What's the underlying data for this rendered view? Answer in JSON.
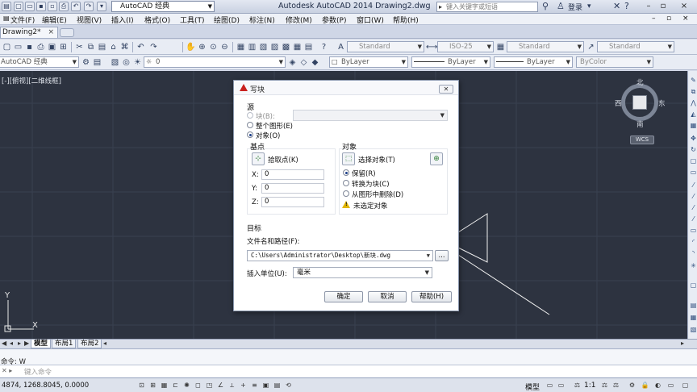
{
  "titlebar": {
    "workspace": "AutoCAD 经典",
    "app_title": "Autodesk AutoCAD 2014    Drawing2.dwg",
    "search_placeholder": "键入关键字或短语",
    "login": "登录"
  },
  "menus": [
    "文件(F)",
    "编辑(E)",
    "视图(V)",
    "插入(I)",
    "格式(O)",
    "工具(T)",
    "绘图(D)",
    "标注(N)",
    "修改(M)",
    "参数(P)",
    "窗口(W)",
    "帮助(H)"
  ],
  "doc_tab": {
    "label": "Drawing2*"
  },
  "toolbar1": {
    "text_style": "Standard",
    "dim_style": "ISO-25",
    "table_style": "Standard",
    "mleader_style": "Standard"
  },
  "toolbar2": {
    "workspace": "AutoCAD 经典",
    "layer": "0",
    "color": "ByLayer",
    "linetype": "ByLayer",
    "lineweight": "ByLayer",
    "plotstyle": "ByColor"
  },
  "canvas": {
    "viewport_label": "[-][俯视][二维线框]",
    "compass": {
      "north": "北",
      "south": "南",
      "east": "东",
      "west": "西"
    },
    "wcs": "WCS",
    "ucs_x": "X",
    "ucs_y": "Y"
  },
  "layout_tabs": [
    "模型",
    "布局1",
    "布局2"
  ],
  "command": {
    "history": "命令: W",
    "placeholder": "键入命令"
  },
  "statusbar": {
    "coords": "4874, 1268.8045, 0.0000",
    "model": "模型",
    "scale": "1:1"
  },
  "dialog": {
    "title": "写块",
    "source_heading": "源",
    "source_block": "块(B):",
    "source_drawing": "整个图形(E)",
    "source_objects": "对象(O)",
    "basepoint_heading": "基点",
    "pick_point": "拾取点(K)",
    "x_label": "X:",
    "x_value": "0",
    "y_label": "Y:",
    "y_value": "0",
    "z_label": "Z:",
    "z_value": "0",
    "objects_heading": "对象",
    "select_objects": "选择对象(T)",
    "retain": "保留(R)",
    "convert": "转换为块(C)",
    "delete": "从图形中删除(D)",
    "no_selection": "未选定对象",
    "target_heading": "目标",
    "filename_label": "文件名和路径(F):",
    "filename_value": "C:\\Users\\Administrator\\Desktop\\新块.dwg",
    "browse": "...",
    "units_label": "插入单位(U):",
    "units_value": "毫米",
    "ok": "确定",
    "cancel": "取消",
    "help": "帮助(H)"
  }
}
